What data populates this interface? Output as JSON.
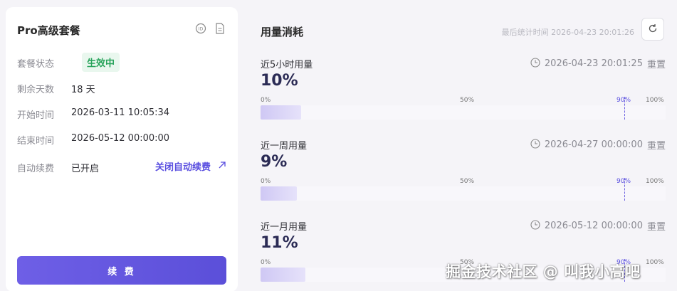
{
  "plan_card": {
    "title": "Pro高级套餐",
    "rows": [
      {
        "label": "套餐状态",
        "value": "生效中"
      },
      {
        "label": "剩余天数",
        "value": "18 天"
      },
      {
        "label": "开始时间",
        "value": "2026-03-11 10:05:34"
      },
      {
        "label": "结束时间",
        "value": "2026-05-12 00:00:00"
      },
      {
        "label": "自动续费",
        "value": "已开启"
      }
    ],
    "auto_renew_action": "关闭自动续费",
    "renew_button": "续 费",
    "icons": [
      "id-card-icon",
      "document-icon",
      "arrow-up-right-icon"
    ]
  },
  "usage_panel": {
    "title": "用量消耗",
    "last_stat": "最后统计时间 2026-04-23 20:01:26",
    "refresh_icon": "refresh-icon",
    "scale_labels": [
      "0%",
      "50%",
      "90%",
      "100%"
    ],
    "threshold_percent": 90,
    "items": [
      {
        "name": "近5小时用量",
        "reset_time": "2026-04-23 20:01:25",
        "reset_label": "重置",
        "percent_label": "10%",
        "percent": 10
      },
      {
        "name": "近一周用量",
        "reset_time": "2026-04-27 00:00:00",
        "reset_label": "重置",
        "percent_label": "9%",
        "percent": 9
      },
      {
        "name": "近一月用量",
        "reset_time": "2026-05-12 00:00:00",
        "reset_label": "重置",
        "percent_label": "11%",
        "percent": 11
      }
    ]
  },
  "watermark": "掘金技术社区 @ 叫我小高吧",
  "colors": {
    "accent": "#5a4fe0",
    "status_green": "#27a35a",
    "status_bg": "#e9f7ee"
  }
}
